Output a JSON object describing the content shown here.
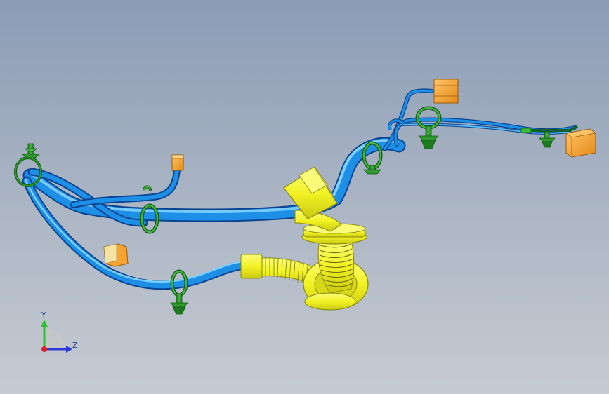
{
  "viewport": {
    "background_top": "#8b9cb6",
    "background_bottom": "#c6cbd2"
  },
  "colors": {
    "tube": "#1e8fe6",
    "tube_dark": "#0b4f9e",
    "tube_light": "#6cc4ff",
    "corrugated": "#f2f224",
    "corrugated_dark": "#8a8a10",
    "clip": "#2f9a2f",
    "clip_dark": "#135a13",
    "connector": "#f7a431",
    "connector_dark": "#9a5a0a",
    "connector_cream": "#f6e3a3"
  },
  "triad": {
    "y_label": "Y",
    "z_label": "Z",
    "y_color": "#2ec12e",
    "z_color": "#2b3ad6",
    "origin_color": "#e0202a"
  }
}
